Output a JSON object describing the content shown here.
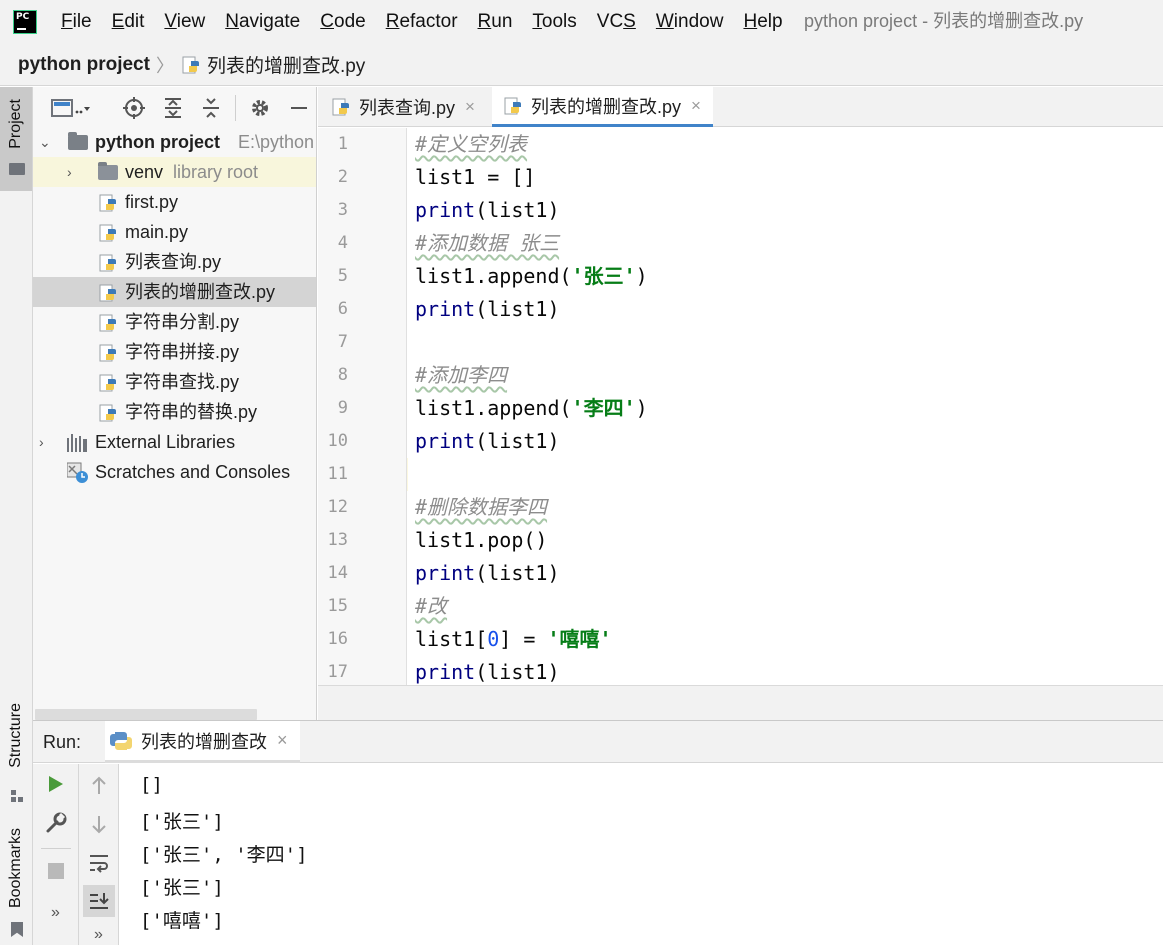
{
  "window_title": "python project - 列表的增删查改.py",
  "menu": [
    {
      "label": "File",
      "mnemonic": "F",
      "rest": "ile"
    },
    {
      "label": "Edit",
      "mnemonic": "E",
      "rest": "dit"
    },
    {
      "label": "View",
      "mnemonic": "V",
      "rest": "iew"
    },
    {
      "label": "Navigate",
      "mnemonic": "N",
      "rest": "avigate"
    },
    {
      "label": "Code",
      "mnemonic": "C",
      "rest": "ode"
    },
    {
      "label": "Refactor",
      "mnemonic": "R",
      "rest": "efactor"
    },
    {
      "label": "Run",
      "mnemonic": "R",
      "rest": "un"
    },
    {
      "label": "Tools",
      "mnemonic": "T",
      "rest": "ools"
    },
    {
      "label": "VCS",
      "mnemonic": "S",
      "rest": "VC"
    },
    {
      "label": "Window",
      "mnemonic": "W",
      "rest": "indow"
    },
    {
      "label": "Help",
      "mnemonic": "H",
      "rest": "elp"
    }
  ],
  "app_logo_text": "PC",
  "breadcrumb": {
    "project": "python project",
    "file": "列表的增删查改.py"
  },
  "left_strip": {
    "project": "Project",
    "structure": "Structure",
    "bookmarks": "Bookmarks"
  },
  "project_tree": {
    "root": {
      "label": "python project",
      "path": "E:\\python"
    },
    "venv": {
      "label": "venv",
      "hint": "library root"
    },
    "files": [
      "first.py",
      "main.py",
      "列表查询.py",
      "列表的增删查改.py",
      "字符串分割.py",
      "字符串拼接.py",
      "字符串查找.py",
      "字符串的替换.py"
    ],
    "external": "External Libraries",
    "scratches": "Scratches and Consoles"
  },
  "editor_tabs": [
    {
      "label": "列表查询.py",
      "active": false
    },
    {
      "label": "列表的增删查改.py",
      "active": true
    }
  ],
  "code": {
    "line_numbers": [
      "1",
      "2",
      "3",
      "4",
      "5",
      "6",
      "7",
      "8",
      "9",
      "10",
      "11",
      "12",
      "13",
      "14",
      "15",
      "16",
      "17"
    ],
    "lines": [
      [
        {
          "t": "cmt",
          "v": "#定义空列表"
        }
      ],
      [
        {
          "t": "txt",
          "v": "list1 = []"
        }
      ],
      [
        {
          "t": "kw",
          "v": "print"
        },
        {
          "t": "txt",
          "v": "(list1)"
        }
      ],
      [
        {
          "t": "cmt",
          "v": "#添加数据 张三"
        }
      ],
      [
        {
          "t": "txt",
          "v": "list1.append("
        },
        {
          "t": "str",
          "v": "'张三'"
        },
        {
          "t": "txt",
          "v": ")"
        }
      ],
      [
        {
          "t": "kw",
          "v": "print"
        },
        {
          "t": "txt",
          "v": "(list1)"
        }
      ],
      [],
      [
        {
          "t": "cmt",
          "v": "#添加李四"
        }
      ],
      [
        {
          "t": "txt",
          "v": "list1.append("
        },
        {
          "t": "str",
          "v": "'李四'"
        },
        {
          "t": "txt",
          "v": ")"
        }
      ],
      [
        {
          "t": "kw",
          "v": "print"
        },
        {
          "t": "txt",
          "v": "(list1)"
        }
      ],
      [],
      [
        {
          "t": "cmt",
          "v": "#删除数据李四"
        }
      ],
      [
        {
          "t": "txt",
          "v": "list1.pop()"
        }
      ],
      [
        {
          "t": "kw",
          "v": "print"
        },
        {
          "t": "txt",
          "v": "(list1)"
        }
      ],
      [
        {
          "t": "cmt",
          "v": "#改"
        }
      ],
      [
        {
          "t": "txt",
          "v": "list1["
        },
        {
          "t": "num",
          "v": "0"
        },
        {
          "t": "txt",
          "v": "] = "
        },
        {
          "t": "str",
          "v": "'嘻嘻'"
        }
      ],
      [
        {
          "t": "kw",
          "v": "print"
        },
        {
          "t": "txt",
          "v": "(list1)"
        }
      ]
    ]
  },
  "run": {
    "label": "Run:",
    "tab": "列表的增删查改",
    "console_lines": [
      "[]",
      "['张三']",
      "['张三', '李四']",
      "['张三']",
      "['嘻嘻']"
    ]
  },
  "colors": {
    "accent": "#4083c9",
    "caret_line": "#fcf8e0",
    "string": "#067d17",
    "keyword": "#000080",
    "comment": "#8c8c8c"
  }
}
